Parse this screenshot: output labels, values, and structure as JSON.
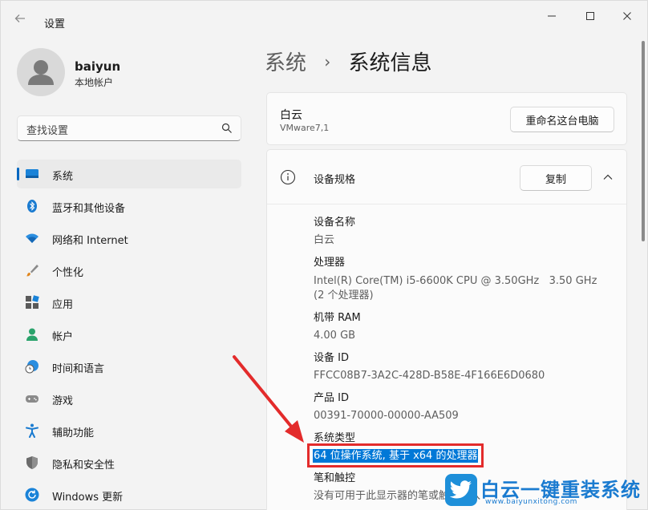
{
  "window": {
    "title": "设置",
    "back_icon": "back-arrow-icon",
    "controls": {
      "minimize": "—",
      "maximize": "☐",
      "close": "✕"
    }
  },
  "account": {
    "name": "baiyun",
    "type": "本地帐户"
  },
  "search": {
    "placeholder": "查找设置"
  },
  "nav": [
    {
      "label": "系统",
      "icon": "system-monitor-icon",
      "active": true
    },
    {
      "label": "蓝牙和其他设备",
      "icon": "bluetooth-icon",
      "active": false
    },
    {
      "label": "网络和 Internet",
      "icon": "wifi-icon",
      "active": false
    },
    {
      "label": "个性化",
      "icon": "paintbrush-icon",
      "active": false
    },
    {
      "label": "应用",
      "icon": "apps-icon",
      "active": false
    },
    {
      "label": "帐户",
      "icon": "account-icon",
      "active": false
    },
    {
      "label": "时间和语言",
      "icon": "time-language-icon",
      "active": false
    },
    {
      "label": "游戏",
      "icon": "gamepad-icon",
      "active": false
    },
    {
      "label": "辅助功能",
      "icon": "accessibility-icon",
      "active": false
    },
    {
      "label": "隐私和安全性",
      "icon": "shield-icon",
      "active": false
    },
    {
      "label": "Windows 更新",
      "icon": "windows-update-icon",
      "active": false
    }
  ],
  "breadcrumb": {
    "parent": "系统",
    "separator": "›",
    "current": "系统信息"
  },
  "pc": {
    "name": "白云",
    "model": "VMware7,1",
    "rename_button": "重命名这台电脑"
  },
  "specs": {
    "title": "设备规格",
    "copy_button": "复制",
    "items": [
      {
        "label": "设备名称",
        "value": "白云"
      },
      {
        "label": "处理器",
        "value": "Intel(R) Core(TM) i5-6600K CPU @ 3.50GHz   3.50 GHz",
        "value2": "(2 个处理器)"
      },
      {
        "label": "机带 RAM",
        "value": "4.00 GB"
      },
      {
        "label": "设备 ID",
        "value": "FFCC08B7-3A2C-428D-B58E-4F166E6D0680"
      },
      {
        "label": "产品 ID",
        "value": "00391-70000-00000-AA509"
      },
      {
        "label": "系统类型",
        "value": "64 位操作系统, 基于 x64 的处理器"
      },
      {
        "label": "笔和触控",
        "value": "没有可用于此显示器的笔或触控输入"
      }
    ]
  },
  "watermark": {
    "text": "白云一键重装系统",
    "url": "www.baiyunxitong.com"
  },
  "colors": {
    "accent": "#0067c0",
    "highlight_border": "#e32b2b",
    "selection": "#0078d7"
  }
}
